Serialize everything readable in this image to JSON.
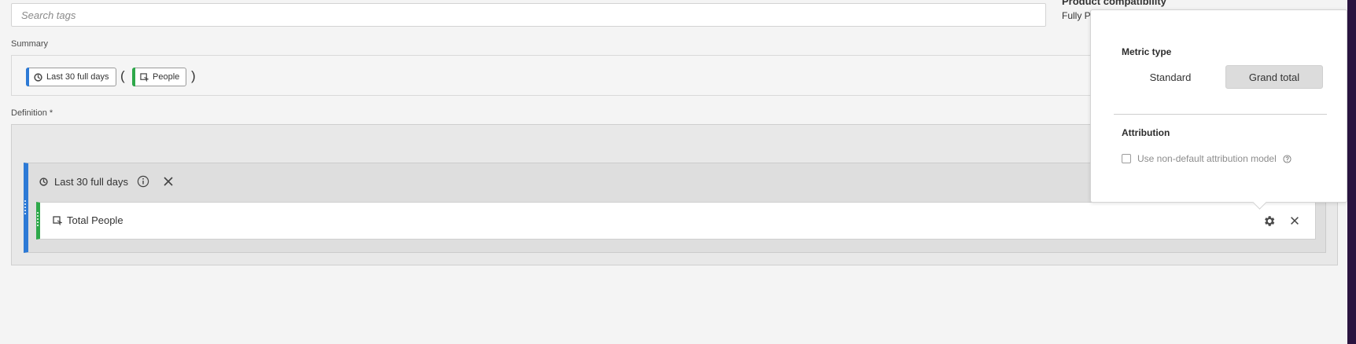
{
  "search": {
    "placeholder": "Search tags",
    "value": ""
  },
  "product_compatibility": {
    "title": "Product compatibility",
    "value": "Fully P"
  },
  "summary": {
    "label": "Summary",
    "chips": [
      {
        "label": "Last 30 full days",
        "icon": "date-range-icon",
        "color": "#2d7ad6"
      },
      {
        "label": "People",
        "icon": "metric-icon",
        "color": "#2ea84a"
      }
    ],
    "open_paren": "(",
    "close_paren": ")"
  },
  "definition": {
    "label": "Definition",
    "required_mark": "*",
    "container": {
      "label": "Last 30 full days",
      "icon": "date-range-icon",
      "color": "#2d7ad6",
      "metric": {
        "label": "Total People",
        "icon": "metric-icon",
        "color": "#2ea84a"
      }
    }
  },
  "popover": {
    "metric_type_heading": "Metric type",
    "options": [
      "Standard",
      "Grand total"
    ],
    "selected_option": "Grand total",
    "attribution_heading": "Attribution",
    "checkbox_label": "Use non-default attribution model",
    "checkbox_checked": false
  }
}
